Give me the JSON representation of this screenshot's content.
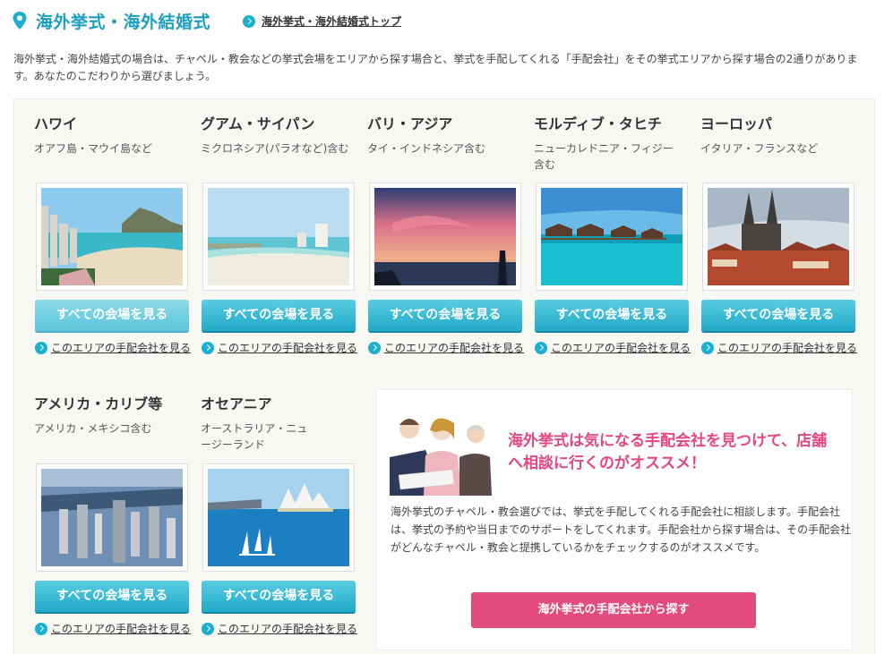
{
  "header": {
    "title": "海外挙式・海外結婚式",
    "top_link": "海外挙式・海外結婚式トップ"
  },
  "intro": "海外挙式・海外結婚式の場合は、チャペル・教会などの挙式会場をエリアから探す場合と、挙式を手配してくれる「手配会社」をその挙式エリアから探す場合の2通りがあります。あなたのこだわりから選びましょう。",
  "areas": [
    {
      "name": "ハワイ",
      "sub": "オアフ島・マウイ島など",
      "button": "すべての会場を見る",
      "link": "このエリアの手配会社を見る"
    },
    {
      "name": "グアム・サイパン",
      "sub": "ミクロネシア(パラオなど)含む",
      "button": "すべての会場を見る",
      "link": "このエリアの手配会社を見る"
    },
    {
      "name": "バリ・アジア",
      "sub": "タイ・インドネシア含む",
      "button": "すべての会場を見る",
      "link": "このエリアの手配会社を見る"
    },
    {
      "name": "モルディブ・タヒチ",
      "sub": "ニューカレドニア・フィジー含む",
      "button": "すべての会場を見る",
      "link": "このエリアの手配会社を見る"
    },
    {
      "name": "ヨーロッパ",
      "sub": "イタリア・フランスなど",
      "button": "すべての会場を見る",
      "link": "このエリアの手配会社を見る"
    },
    {
      "name": "アメリカ・カリブ等",
      "sub": "アメリカ・メキシコ含む",
      "button": "すべての会場を見る",
      "link": "このエリアの手配会社を見る"
    },
    {
      "name": "オセアニア",
      "sub": "オーストラリア・ニュージーランド",
      "button": "すべての会場を見る",
      "link": "このエリアの手配会社を見る"
    }
  ],
  "promo": {
    "headline": "海外挙式は気になる手配会社を見つけて、店舗へ相談に行くのがオススメ！",
    "body": "海外挙式のチャペル・教会選びでは、挙式を手配してくれる手配会社に相談します。手配会社は、挙式の予約や当日までのサポートをしてくれます。手配会社から探す場合は、その手配会社がどんなチャペル・教会と提携しているかをチェックするのがオススメです。",
    "button": "海外挙式の手配会社から探す"
  },
  "colors": {
    "accent": "#1a9fc0",
    "pink": "#e34a7d",
    "panel": "#f7f7f4"
  }
}
